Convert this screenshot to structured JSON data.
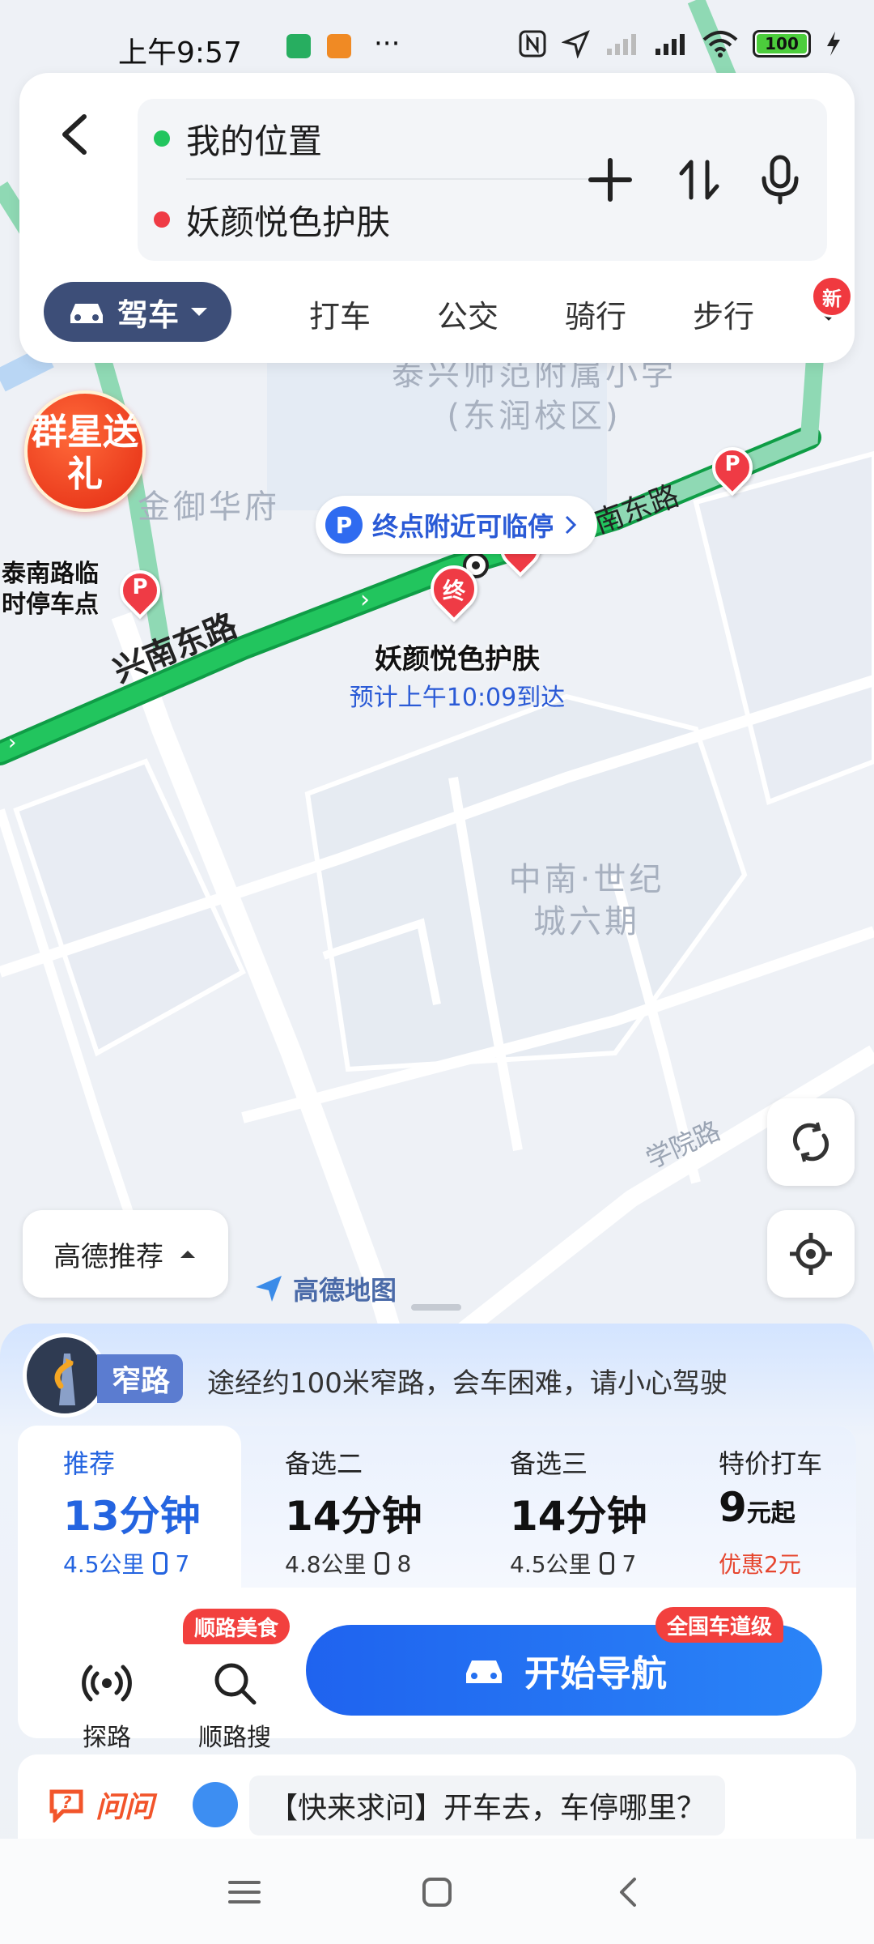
{
  "status_bar": {
    "time": "上午9:57",
    "more": "···",
    "battery": "100"
  },
  "search": {
    "origin": "我的位置",
    "destination": "妖颜悦色护肤"
  },
  "mode_tabs": {
    "drive": "驾车",
    "taxi": "打车",
    "bus": "公交",
    "ride": "骑行",
    "walk": "步行",
    "new_badge": "新"
  },
  "map": {
    "area_labels": [
      "泰兴师范附属小学(东润校区)",
      "金御华府",
      "中南·世纪城六期"
    ],
    "road_main": "兴南东路",
    "road_main_right": "南东路",
    "road_gray": "学院路",
    "promo": "群星送礼",
    "parking_tip": "终点附近可临停",
    "parking_left": "泰南路临时停车点",
    "dest_pin": "终",
    "dest_name": "妖颜悦色护肤",
    "dest_eta": "预计上午10:09到达",
    "logo": "高德地图",
    "strategy": "高德推荐",
    "parking_pin": "P"
  },
  "warning": {
    "tag": "窄路",
    "text": "途经约100米窄路，会车困难，请小心驾驶"
  },
  "routes": [
    {
      "label": "推荐",
      "time": "13分钟",
      "distance": "4.5公里",
      "lights": "7",
      "selected": true
    },
    {
      "label": "备选二",
      "time": "14分钟",
      "distance": "4.8公里",
      "lights": "8",
      "selected": false
    },
    {
      "label": "备选三",
      "time": "14分钟",
      "distance": "4.5公里",
      "lights": "7",
      "selected": false
    }
  ],
  "taxi_option": {
    "label": "特价打车",
    "price": "9",
    "unit": "元起",
    "discount": "优惠2元"
  },
  "tools": {
    "explore": "探路",
    "along_search": "顺路搜",
    "food_badge": "顺路美食"
  },
  "navigate": {
    "label": "开始导航",
    "badge": "全国车道级"
  },
  "ask": {
    "logo": "问问",
    "text": "【快来求问】开车去，车停哪里？"
  },
  "colors": {
    "route_green": "#1db954",
    "accent_blue": "#2464e0",
    "drive_tab": "#3d4e78",
    "alert_red": "#f2403e"
  }
}
